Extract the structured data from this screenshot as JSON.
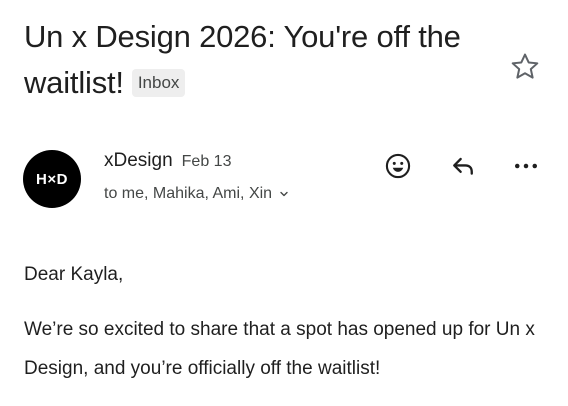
{
  "email": {
    "subject": "Un x Design 2026: You're off the waitlist!",
    "label_badge": "Inbox",
    "sender": {
      "avatar_initials": "H×D",
      "name": "xDesign",
      "date": "Feb 13",
      "recipients": "to me, Mahika, Ami, Xin"
    },
    "body": {
      "greeting": "Dear Kayla,",
      "paragraph": "We’re so excited to share that a spot has opened up for Un x Design, and you’re officially off the waitlist!"
    }
  },
  "icons": {
    "star": "star-outline-icon",
    "emoji": "add-reaction-icon",
    "reply": "reply-icon",
    "more": "more-vertical-icon",
    "expand_recipients": "chevron-down-icon"
  },
  "colors": {
    "text_primary": "#1f1f1f",
    "text_secondary": "#444746",
    "badge_bg": "#eeeeee",
    "avatar_bg": "#000000"
  }
}
